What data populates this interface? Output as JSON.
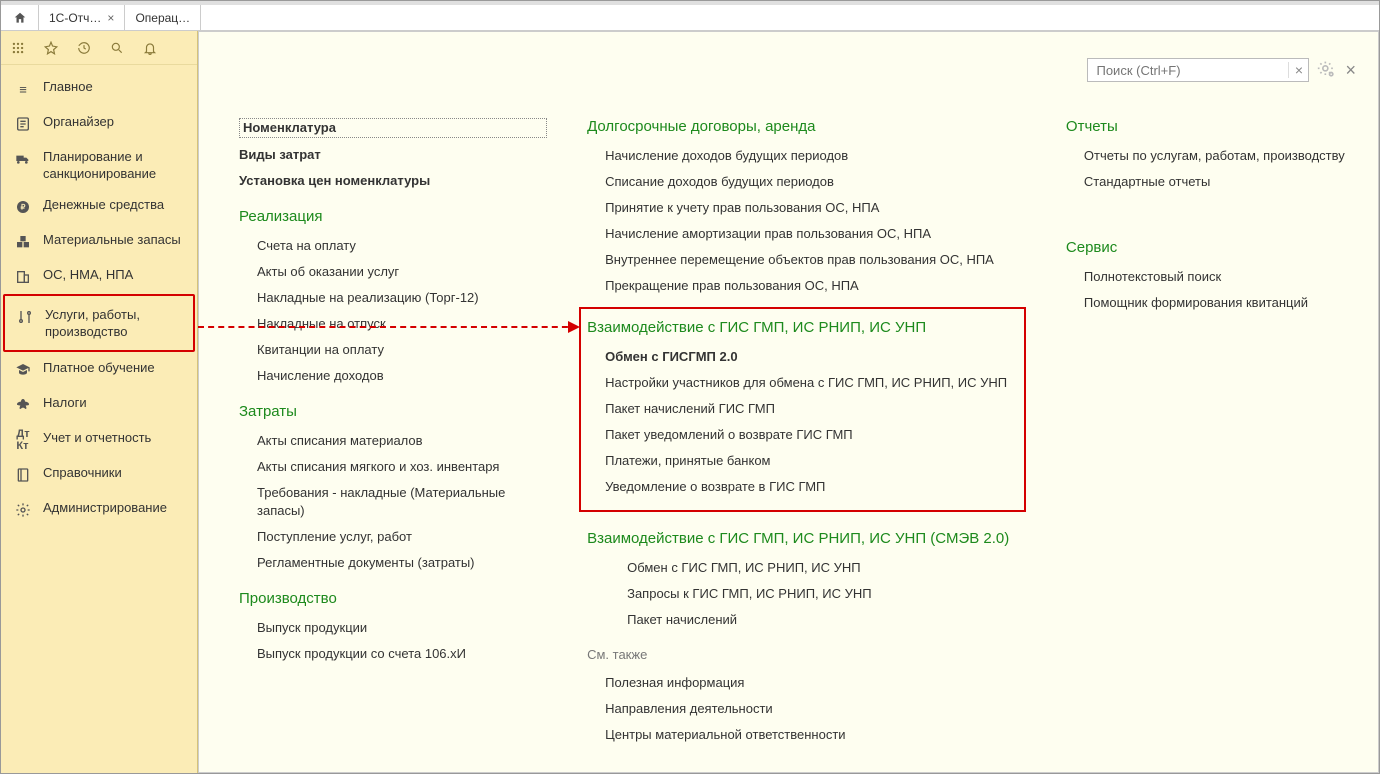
{
  "tabs": {
    "t1": "1С-Отч…",
    "t2": "Операц…"
  },
  "search": {
    "placeholder": "Поиск (Ctrl+F)"
  },
  "nav": {
    "main": "Главное",
    "organizer": "Органайзер",
    "plan": "Планирование и санкционирование",
    "money": "Денежные средства",
    "stocks": "Материальные запасы",
    "os": "ОС, НМА, НПА",
    "services": "Услуги, работы, производство",
    "paid": "Платное обучение",
    "taxes": "Налоги",
    "accounting": "Учет и отчетность",
    "refs": "Справочники",
    "admin": "Администрирование"
  },
  "col1": {
    "nomen": "Номенклатура",
    "costs_kinds": "Виды затрат",
    "set_prices": "Установка цен номенклатуры",
    "realization": "Реализация",
    "r_items": {
      "0": "Счета на оплату",
      "1": "Акты об оказании услуг",
      "2": "Накладные на реализацию (Торг-12)",
      "3": "Накладные на отпуск",
      "4": "Квитанции на оплату",
      "5": "Начисление доходов"
    },
    "costs": "Затраты",
    "c_items": {
      "0": "Акты списания материалов",
      "1": "Акты списания мягкого и хоз. инвентаря",
      "2": "Требования - накладные (Материальные запасы)",
      "3": "Поступление услуг, работ",
      "4": "Регламентные документы (затраты)"
    },
    "prod": "Производство",
    "p_items": {
      "0": "Выпуск продукции",
      "1": "Выпуск продукции со счета 106.хИ"
    }
  },
  "col2": {
    "long": "Долгосрочные договоры, аренда",
    "l_items": {
      "0": "Начисление доходов будущих периодов",
      "1": "Списание доходов будущих периодов",
      "2": "Принятие к учету прав пользования ОС, НПА",
      "3": "Начисление амортизации прав пользования ОС, НПА",
      "4": "Внутреннее перемещение объектов прав пользования ОС, НПА",
      "5": "Прекращение прав пользования ОС, НПА"
    },
    "gis": "Взаимодействие с ГИС ГМП, ИС РНИП, ИС УНП",
    "g_items": {
      "0": "Обмен с ГИСГМП 2.0",
      "1": "Настройки участников для обмена с ГИС ГМП, ИС РНИП, ИС УНП",
      "2": "Пакет начислений ГИС ГМП",
      "3": "Пакет уведомлений о возврате ГИС ГМП",
      "4": "Платежи, принятые банком",
      "5": "Уведомление о возврате в ГИС ГМП"
    },
    "smev": "Взаимодействие с ГИС ГМП, ИС РНИП, ИС УНП (СМЭВ 2.0)",
    "s_items": {
      "0": "Обмен с ГИС ГМП, ИС РНИП, ИС УНП",
      "1": "Запросы к ГИС ГМП, ИС РНИП, ИС УНП",
      "2": "Пакет начислений"
    },
    "see_also": "См. также",
    "sa_items": {
      "0": "Полезная информация",
      "1": "Направления деятельности",
      "2": "Центры материальной ответственности"
    }
  },
  "col3": {
    "reports": "Отчеты",
    "r_items": {
      "0": "Отчеты по услугам, работам, производству",
      "1": "Стандартные отчеты"
    },
    "service": "Сервис",
    "s_items": {
      "0": "Полнотекстовый поиск",
      "1": "Помощник формирования квитанций"
    }
  }
}
